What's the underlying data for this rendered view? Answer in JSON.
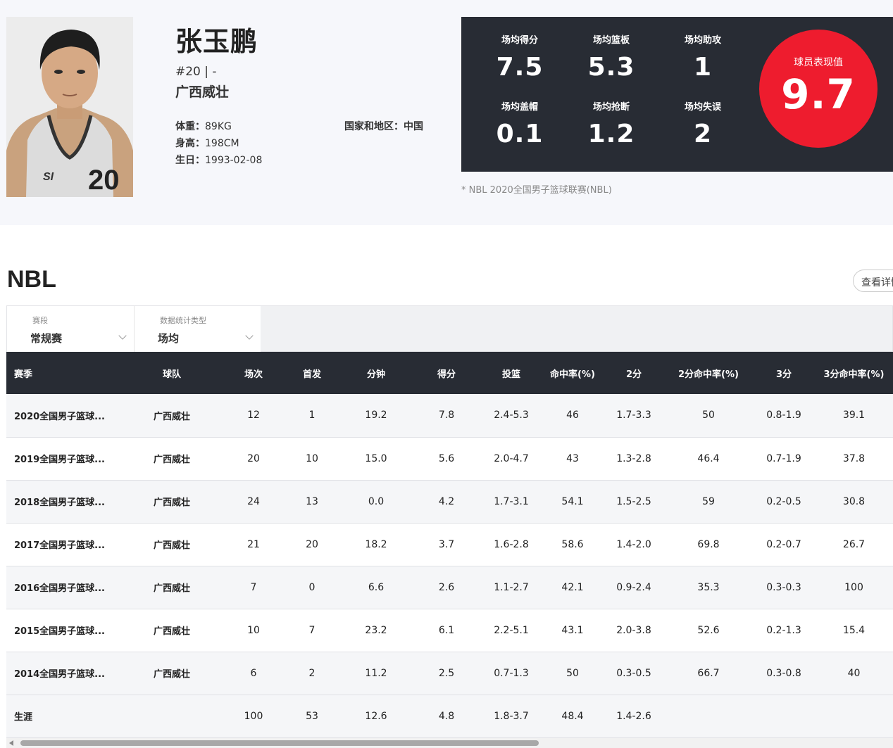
{
  "player": {
    "name": "张玉鹏",
    "number_line": "#20 | -",
    "team": "广西威壮",
    "weight_label": "体重：",
    "weight": "89KG",
    "height_label": "身高：",
    "height": "198CM",
    "birth_label": "生日：",
    "birth": "1993-02-08",
    "country_label": "国家和地区：",
    "country": "中国",
    "jersey_print": "20"
  },
  "averages": {
    "points": {
      "label": "场均得分",
      "value": "7.5"
    },
    "rebounds": {
      "label": "场均篮板",
      "value": "5.3"
    },
    "assists": {
      "label": "场均助攻",
      "value": "1"
    },
    "blocks": {
      "label": "场均盖帽",
      "value": "0.1"
    },
    "steals": {
      "label": "场均抢断",
      "value": "1.2"
    },
    "turnovers": {
      "label": "场均失误",
      "value": "2"
    },
    "performance": {
      "label": "球员表现值",
      "value": "9.7"
    },
    "league_note": "* NBL 2020全国男子篮球联赛(NBL)"
  },
  "section": {
    "title": "NBL",
    "detail_button": "查看详情"
  },
  "filters": {
    "stage": {
      "label": "赛段",
      "value": "常规赛"
    },
    "stat_type": {
      "label": "数据统计类型",
      "value": "场均"
    }
  },
  "table": {
    "headers": [
      "赛季",
      "球队",
      "场次",
      "首发",
      "分钟",
      "得分",
      "投篮",
      "命中率(%)",
      "2分",
      "2分命中率(%)",
      "3分",
      "3分命中率(%)"
    ],
    "rows": [
      [
        "2020全国男子篮球...",
        "广西威壮",
        "12",
        "1",
        "19.2",
        "7.8",
        "2.4-5.3",
        "46",
        "1.7-3.3",
        "50",
        "0.8-1.9",
        "39.1"
      ],
      [
        "2019全国男子篮球...",
        "广西威壮",
        "20",
        "10",
        "15.0",
        "5.6",
        "2.0-4.7",
        "43",
        "1.3-2.8",
        "46.4",
        "0.7-1.9",
        "37.8"
      ],
      [
        "2018全国男子篮球...",
        "广西威壮",
        "24",
        "13",
        "0.0",
        "4.2",
        "1.7-3.1",
        "54.1",
        "1.5-2.5",
        "59",
        "0.2-0.5",
        "30.8"
      ],
      [
        "2017全国男子篮球...",
        "广西威壮",
        "21",
        "20",
        "18.2",
        "3.7",
        "1.6-2.8",
        "58.6",
        "1.4-2.0",
        "69.8",
        "0.2-0.7",
        "26.7"
      ],
      [
        "2016全国男子篮球...",
        "广西威壮",
        "7",
        "0",
        "6.6",
        "2.6",
        "1.1-2.7",
        "42.1",
        "0.9-2.4",
        "35.3",
        "0.3-0.3",
        "100"
      ],
      [
        "2015全国男子篮球...",
        "广西威壮",
        "10",
        "7",
        "23.2",
        "6.1",
        "2.2-5.1",
        "43.1",
        "2.0-3.8",
        "52.6",
        "0.2-1.3",
        "15.4"
      ],
      [
        "2014全国男子篮球...",
        "广西威壮",
        "6",
        "2",
        "11.2",
        "2.5",
        "0.7-1.3",
        "50",
        "0.3-0.5",
        "66.7",
        "0.3-0.8",
        "40"
      ],
      [
        "生涯",
        "",
        "100",
        "53",
        "12.6",
        "4.8",
        "1.8-3.7",
        "48.4",
        "1.4-2.6",
        "",
        "",
        ""
      ]
    ]
  },
  "colors": {
    "panel_dark": "#282c34",
    "accent_red": "#ee1c2e",
    "band_bg": "#f6f7fb"
  }
}
